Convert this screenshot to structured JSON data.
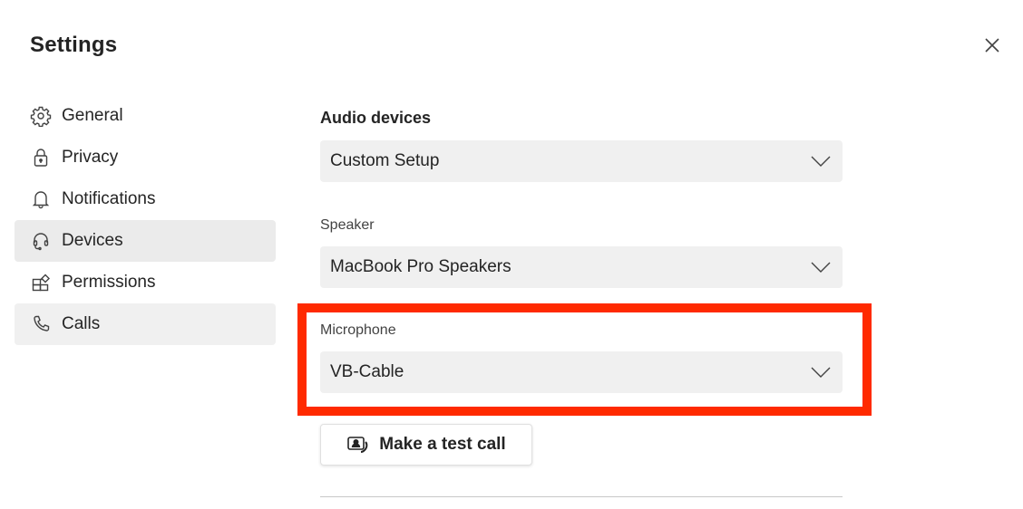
{
  "window": {
    "title": "Settings",
    "close_icon": "close-icon"
  },
  "sidebar": {
    "items": [
      {
        "label": "General",
        "icon": "gear-icon",
        "state": "normal"
      },
      {
        "label": "Privacy",
        "icon": "lock-icon",
        "state": "normal"
      },
      {
        "label": "Notifications",
        "icon": "bell-icon",
        "state": "normal"
      },
      {
        "label": "Devices",
        "icon": "headset-icon",
        "state": "active"
      },
      {
        "label": "Permissions",
        "icon": "apps-add-icon",
        "state": "normal"
      },
      {
        "label": "Calls",
        "icon": "phone-icon",
        "state": "hover"
      }
    ]
  },
  "main": {
    "section_title": "Audio devices",
    "audio_setup": {
      "value": "Custom Setup"
    },
    "speaker": {
      "label": "Speaker",
      "value": "MacBook Pro Speakers"
    },
    "microphone": {
      "label": "Microphone",
      "value": "VB-Cable"
    },
    "test_call_button": {
      "label": "Make a test call",
      "icon": "video-person-call-icon"
    }
  },
  "annotation": {
    "highlight_color": "#ff2a00",
    "target": "microphone"
  },
  "colors": {
    "dropdown_bg": "#f0f0f0",
    "active_nav_bg": "#ebebeb",
    "text": "#242424"
  }
}
